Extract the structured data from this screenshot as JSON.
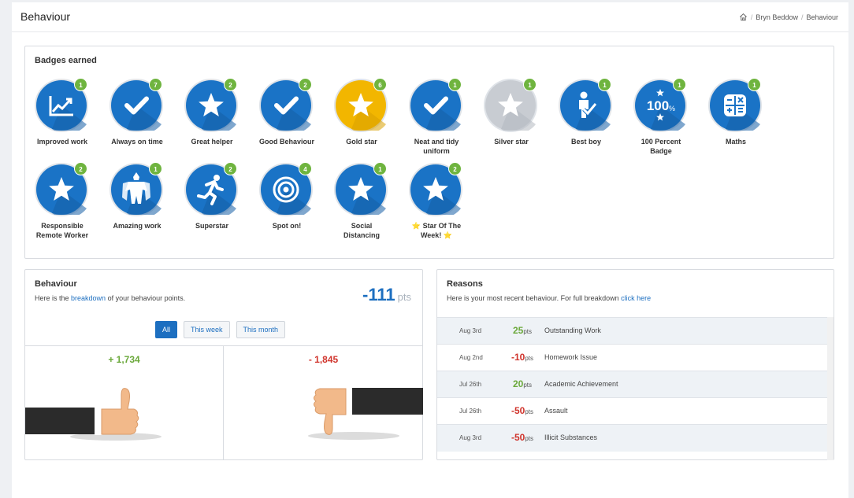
{
  "header": {
    "title": "Behaviour",
    "breadcrumb": [
      "Bryn Beddow",
      "Behaviour"
    ]
  },
  "badges": {
    "title": "Badges earned",
    "items": [
      {
        "label": "Improved work",
        "count": "1",
        "icon": "trend-chart-icon",
        "color": "#1a73c6"
      },
      {
        "label": "Always on time",
        "count": "7",
        "icon": "check-icon",
        "color": "#1a73c6"
      },
      {
        "label": "Great helper",
        "count": "2",
        "icon": "star-icon",
        "color": "#1a73c6"
      },
      {
        "label": "Good Behaviour",
        "count": "2",
        "icon": "check-icon",
        "color": "#1a73c6"
      },
      {
        "label": "Gold star",
        "count": "6",
        "icon": "star-icon",
        "color": "#f2b600"
      },
      {
        "label": "Neat and tidy uniform",
        "count": "1",
        "icon": "check-icon",
        "color": "#1a73c6"
      },
      {
        "label": "Silver star",
        "count": "1",
        "icon": "star-icon",
        "color": "#c8ccd2"
      },
      {
        "label": "Best boy",
        "count": "1",
        "icon": "person-check-icon",
        "color": "#1a73c6"
      },
      {
        "label": "100 Percent Badge",
        "count": "1",
        "icon": "hundred-percent-icon",
        "color": "#1a73c6"
      },
      {
        "label": "Maths",
        "count": "1",
        "icon": "calculator-icon",
        "color": "#1a73c6"
      },
      {
        "label": "Responsible Remote Worker",
        "count": "2",
        "icon": "star-icon",
        "color": "#1a73c6"
      },
      {
        "label": "Amazing work",
        "count": "1",
        "icon": "superhero-icon",
        "color": "#1a73c6"
      },
      {
        "label": "Superstar",
        "count": "2",
        "icon": "runner-icon",
        "color": "#1a73c6"
      },
      {
        "label": "Spot on!",
        "count": "4",
        "icon": "target-icon",
        "color": "#1a73c6"
      },
      {
        "label": "Social Distancing",
        "count": "1",
        "icon": "star-icon",
        "color": "#1a73c6"
      },
      {
        "label": "⭐ Star Of The Week! ⭐",
        "count": "2",
        "icon": "star-icon",
        "color": "#1a73c6"
      }
    ]
  },
  "behaviour": {
    "title": "Behaviour",
    "subtitle_pre": "Here is the ",
    "subtitle_link": "breakdown",
    "subtitle_post": " of your behaviour points.",
    "points": "-111",
    "points_unit": "pts",
    "filters": [
      "All",
      "This week",
      "This month"
    ],
    "active_filter": "All",
    "positive": "+ 1,734",
    "negative": "- 1,845"
  },
  "reasons": {
    "title": "Reasons",
    "subtitle_pre": "Here is your most recent behaviour. For full breakdown ",
    "subtitle_link": "click here",
    "rows": [
      {
        "date": "Aug 3rd",
        "score": "25",
        "unit": "pts",
        "reason": "Outstanding Work",
        "sign": "pos"
      },
      {
        "date": "Aug 2nd",
        "score": "-10",
        "unit": "pts",
        "reason": "Homework Issue",
        "sign": "neg"
      },
      {
        "date": "Jul 26th",
        "score": "20",
        "unit": "pts",
        "reason": "Academic Achievement",
        "sign": "pos"
      },
      {
        "date": "Jul 26th",
        "score": "-50",
        "unit": "pts",
        "reason": "Assault",
        "sign": "neg"
      },
      {
        "date": "Aug 3rd",
        "score": "-50",
        "unit": "pts",
        "reason": "Illicit Substances",
        "sign": "neg"
      }
    ]
  },
  "colors": {
    "primary": "#1d6fc0",
    "positive": "#6aa83a",
    "negative": "#d0342c",
    "count_badge": "#6fb43f"
  }
}
